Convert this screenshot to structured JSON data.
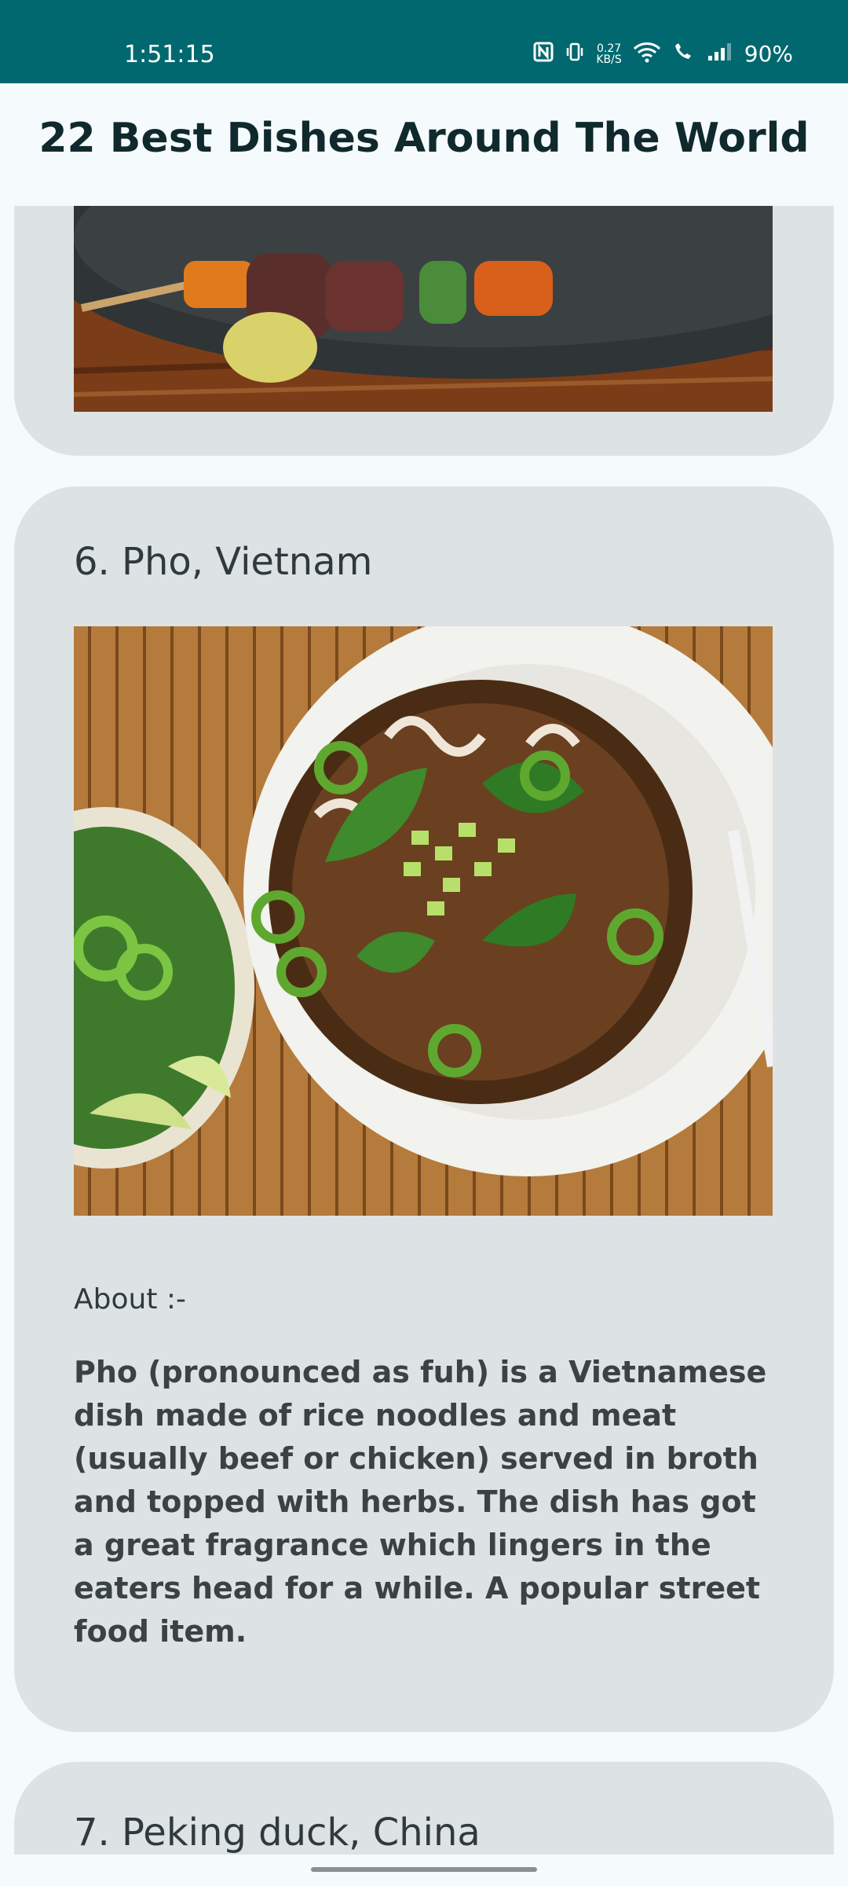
{
  "status_bar": {
    "time": "1:51:15",
    "speed_value": "0.27",
    "speed_unit": "KB/S",
    "battery": "90%"
  },
  "app_bar": {
    "title": "22 Best Dishes Around The World"
  },
  "cards": {
    "pho": {
      "title": "6. Pho, Vietnam",
      "about_label": "About :-",
      "about_text": "Pho (pronounced as fuh) is a Vietnamese dish made of rice noodles and meat (usually beef or chicken) served in broth and topped with herbs. The dish has got a great fragrance which lingers in the eaters head for a while. A popular street food item."
    },
    "peking": {
      "title": "7. Peking duck, China"
    }
  },
  "colors": {
    "status_bar": "#02686f",
    "card_bg": "#dde2e4",
    "page_bg": "#f5fbfc"
  }
}
